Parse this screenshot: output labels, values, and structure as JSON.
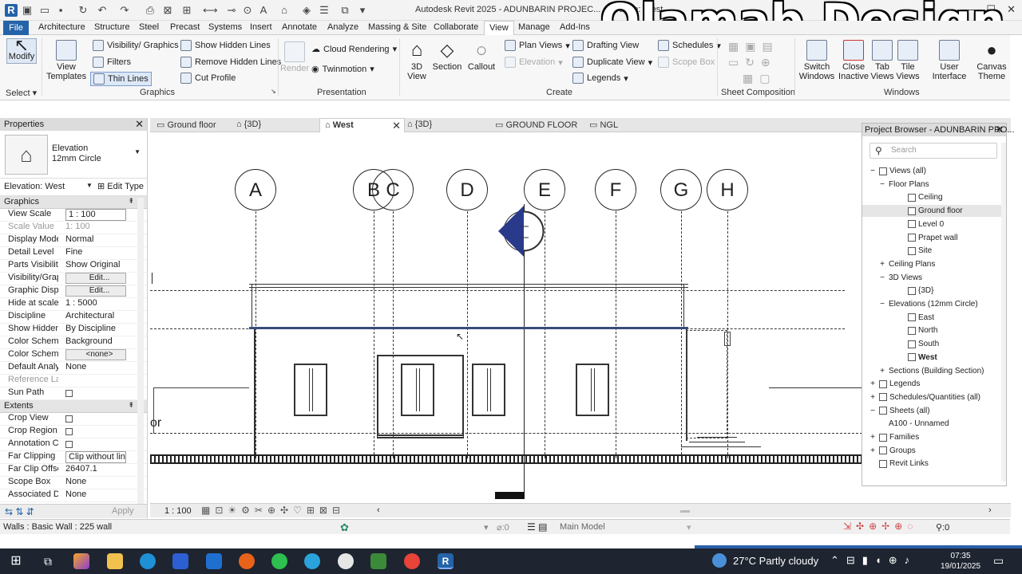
{
  "app": {
    "title": "Autodesk Revit 2025 - ADUNBARIN PROJEC... elevation: West",
    "watermark": "Olamab Design",
    "logo_letter": "R"
  },
  "ribbon_tabs": [
    "File",
    "Architecture",
    "Structure",
    "Steel",
    "Precast",
    "Systems",
    "Insert",
    "Annotate",
    "Analyze",
    "Massing & Site",
    "Collaborate",
    "View",
    "Manage",
    "Add-Ins"
  ],
  "ribbon_active_tab": "View",
  "ribbon": {
    "select_label": "Select",
    "modify": "Modify",
    "view_templates": "View Templates",
    "visibility_graphics": "Visibility/ Graphics",
    "filters": "Filters",
    "thin_lines": "Thin Lines",
    "show_hidden_lines": "Show Hidden Lines",
    "remove_hidden_lines": "Remove Hidden Lines",
    "cut_profile": "Cut Profile",
    "graphics_label": "Graphics",
    "render": "Render",
    "cloud_rendering": "Cloud Rendering",
    "twinmotion": "Twinmotion",
    "presentation_label": "Presentation",
    "view_3d": "3D View",
    "section": "Section",
    "callout": "Callout",
    "plan_views": "Plan Views",
    "elevation": "Elevation",
    "drafting_view": "Drafting View",
    "duplicate_view": "Duplicate View",
    "legends": "Legends",
    "schedules": "Schedules",
    "scope_box": "Scope Box",
    "create_label": "Create",
    "sheet_composition_label": "Sheet Composition",
    "switch_windows": "Switch Windows",
    "close_inactive": "Close Inactive",
    "tab_views": "Tab Views",
    "tile_views": "Tile Views",
    "user_interface": "User Interface",
    "canvas_theme": "Canvas Theme",
    "windows_label": "Windows"
  },
  "properties": {
    "header": "Properties",
    "family": "Elevation",
    "type": "12mm Circle",
    "instance_selector": "Elevation: West",
    "edit_type": "Edit Type",
    "sections": [
      {
        "name": "Graphics",
        "rows": [
          {
            "key": "View Scale",
            "value": "1 : 100",
            "kind": "box"
          },
          {
            "key": "Scale Value",
            "value": "1:  100",
            "kind": "gray"
          },
          {
            "key": "Display Model",
            "value": "Normal"
          },
          {
            "key": "Detail Level",
            "value": "Fine"
          },
          {
            "key": "Parts Visibility",
            "value": "Show Original"
          },
          {
            "key": "Visibility/Grap...",
            "value": "Edit...",
            "kind": "btn"
          },
          {
            "key": "Graphic Displ...",
            "value": "Edit...",
            "kind": "btn"
          },
          {
            "key": "Hide at scales ...",
            "value": "1 : 5000"
          },
          {
            "key": "Discipline",
            "value": "Architectural"
          },
          {
            "key": "Show Hidden ...",
            "value": "By Discipline"
          },
          {
            "key": "Color Scheme ...",
            "value": "Background"
          },
          {
            "key": "Color Scheme",
            "value": "<none>",
            "kind": "btn"
          },
          {
            "key": "Default Analys...",
            "value": "None"
          },
          {
            "key": "Reference Label",
            "value": "",
            "kind": "gray"
          },
          {
            "key": "Sun Path",
            "value": "",
            "kind": "check"
          }
        ]
      },
      {
        "name": "Extents",
        "rows": [
          {
            "key": "Crop View",
            "value": "",
            "kind": "check"
          },
          {
            "key": "Crop Region V...",
            "value": "",
            "kind": "check"
          },
          {
            "key": "Annotation Cr...",
            "value": "",
            "kind": "check"
          },
          {
            "key": "Far Clipping",
            "value": "Clip without line",
            "kind": "box"
          },
          {
            "key": "Far Clip Offset",
            "value": "26407.1"
          },
          {
            "key": "Scope Box",
            "value": "None"
          },
          {
            "key": "Associated Da...",
            "value": "None"
          }
        ]
      }
    ],
    "apply": "Apply"
  },
  "view_tabs": [
    {
      "label": "Ground floor",
      "active": false
    },
    {
      "label": "{3D}",
      "active": false
    },
    {
      "label": "West",
      "active": true
    },
    {
      "label": "{3D}",
      "active": false
    },
    {
      "label": "GROUND FLOOR",
      "active": false
    },
    {
      "label": "NGL",
      "active": false
    }
  ],
  "drawing": {
    "grids": [
      "A",
      "B",
      "C",
      "D",
      "E",
      "F",
      "G",
      "H"
    ],
    "level_text": "or",
    "scale": "1 : 100"
  },
  "project_browser": {
    "header": "Project Browser - ADUNBARIN PRO...",
    "search_placeholder": "Search",
    "tree": [
      {
        "label": "Views (all)",
        "toggle": "−",
        "level": 0,
        "icon": true
      },
      {
        "label": "Floor Plans",
        "toggle": "−",
        "level": 1
      },
      {
        "label": "Ceiling",
        "level": 2,
        "icon": true
      },
      {
        "label": "Ground floor",
        "level": 2,
        "icon": true,
        "selected": true
      },
      {
        "label": "Level 0",
        "level": 2,
        "icon": true
      },
      {
        "label": "Prapet wall",
        "level": 2,
        "icon": true
      },
      {
        "label": "Site",
        "level": 2,
        "icon": true
      },
      {
        "label": "Ceiling Plans",
        "toggle": "+",
        "level": 1
      },
      {
        "label": "3D Views",
        "toggle": "−",
        "level": 1
      },
      {
        "label": "{3D}",
        "level": 2,
        "icon": true
      },
      {
        "label": "Elevations (12mm Circle)",
        "toggle": "−",
        "level": 1
      },
      {
        "label": "East",
        "level": 2,
        "icon": true
      },
      {
        "label": "North",
        "level": 2,
        "icon": true
      },
      {
        "label": "South",
        "level": 2,
        "icon": true
      },
      {
        "label": "West",
        "level": 2,
        "icon": true,
        "bold": true
      },
      {
        "label": "Sections (Building Section)",
        "toggle": "+",
        "level": 1
      },
      {
        "label": "Legends",
        "toggle": "+",
        "level": 0,
        "icon": true
      },
      {
        "label": "Schedules/Quantities (all)",
        "toggle": "+",
        "level": 0,
        "icon": true
      },
      {
        "label": "Sheets (all)",
        "toggle": "−",
        "level": 0,
        "icon": true
      },
      {
        "label": "A100 - Unnamed",
        "level": 1
      },
      {
        "label": "Families",
        "toggle": "+",
        "level": 0,
        "icon": true
      },
      {
        "label": "Groups",
        "toggle": "+",
        "level": 0,
        "icon": true
      },
      {
        "label": "Revit Links",
        "level": 0,
        "icon": true
      }
    ]
  },
  "status": {
    "selection": "Walls : Basic Wall : 225 wall",
    "counter": ":0",
    "workset": "Main Model",
    "filter_count": ":0"
  },
  "taskbar": {
    "weather": "27°C  Partly cloudy",
    "time": "07:35",
    "date": "19/01/2025"
  }
}
